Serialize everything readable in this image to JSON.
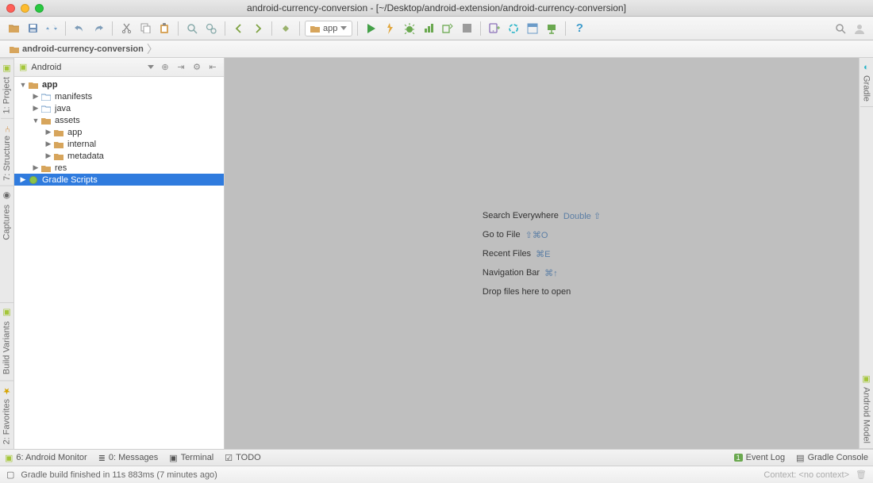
{
  "window": {
    "title": "android-currency-conversion - [~/Desktop/android-extension/android-currency-conversion]"
  },
  "run_config": {
    "label": "app"
  },
  "breadcrumb": {
    "root": "android-currency-conversion"
  },
  "left_gutter": {
    "tab1": "1: Project",
    "tab2": "7: Structure",
    "tab3": "Captures",
    "tab_bottom1": "Build Variants",
    "tab_bottom2": "2: Favorites"
  },
  "right_gutter": {
    "tab1": "Gradle",
    "tab_bottom": "Android Model"
  },
  "project_panel": {
    "view": "Android",
    "tree": {
      "app": "app",
      "manifests": "manifests",
      "java": "java",
      "assets": "assets",
      "assets_app": "app",
      "assets_internal": "internal",
      "assets_metadata": "metadata",
      "res": "res",
      "gradle_scripts": "Gradle Scripts"
    }
  },
  "editor_hints": {
    "r1_label": "Search Everywhere",
    "r1_key": "Double ⇧",
    "r2_label": "Go to File",
    "r2_key": "⇧⌘O",
    "r3_label": "Recent Files",
    "r3_key": "⌘E",
    "r4_label": "Navigation Bar",
    "r4_key": "⌘↑",
    "r5_label": "Drop files here to open"
  },
  "bottom_tabs": {
    "android_monitor": "6: Android Monitor",
    "messages": "0: Messages",
    "terminal": "Terminal",
    "todo": "TODO",
    "event_log": "Event Log",
    "gradle_console": "Gradle Console"
  },
  "statusbar": {
    "msg": "Gradle build finished in 11s 883ms (7 minutes ago)",
    "context": "Context: <no context>"
  }
}
